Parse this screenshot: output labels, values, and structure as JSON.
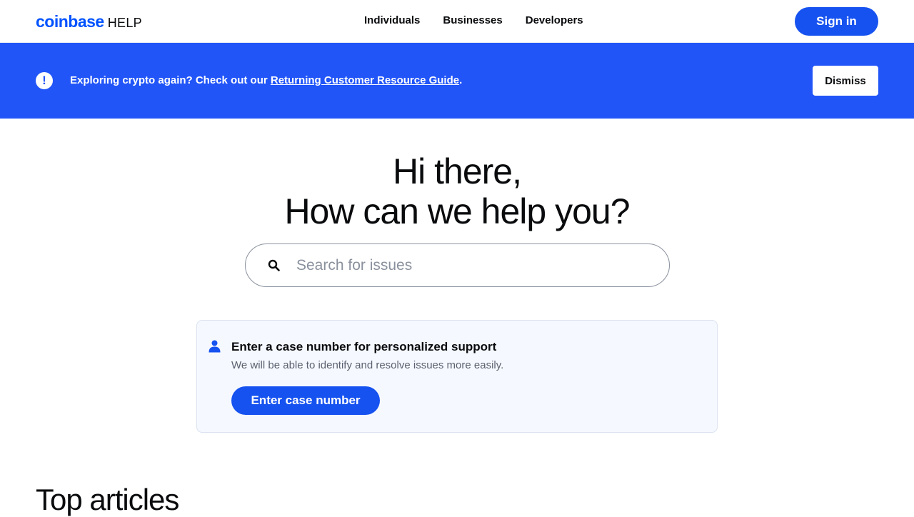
{
  "header": {
    "logo_word": "coinbase",
    "logo_help": "HELP",
    "nav": [
      "Individuals",
      "Businesses",
      "Developers"
    ],
    "sign_in_label": "Sign in"
  },
  "banner": {
    "icon": "exclamation-icon",
    "text_prefix": "Exploring crypto again? Check out our ",
    "link_text": "Returning Customer Resource Guide",
    "text_suffix": ".",
    "dismiss_label": "Dismiss"
  },
  "hero": {
    "greeting": "Hi there,",
    "question": "How can we help you?"
  },
  "search": {
    "placeholder": "Search for issues",
    "value": "",
    "icon": "search-icon"
  },
  "case_card": {
    "icon": "person-icon",
    "title": "Enter a case number for personalized support",
    "subtitle": "We will be able to identify and resolve issues more easily.",
    "button_label": "Enter case number"
  },
  "top_articles": {
    "heading": "Top articles"
  },
  "colors": {
    "brand_blue": "#0052ff",
    "banner_blue": "#2155f8",
    "button_blue": "#1652f0",
    "card_bg": "#f5f8ff",
    "text_muted": "#5b616e"
  }
}
